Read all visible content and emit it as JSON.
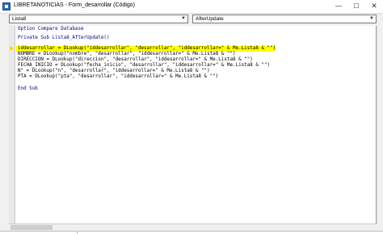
{
  "window": {
    "title": "LIBRETANOTICIAS - Form_desarrollar (Código)",
    "minimize_symbol": "—",
    "maximize_symbol": "☐",
    "close_symbol": "✕"
  },
  "selectors": {
    "object": "Lista8",
    "procedure": "AfterUpdate",
    "arrow_symbol": "▼"
  },
  "code": {
    "lines": [
      "Option Compare Database",
      "",
      "Private Sub Lista8_AfterUpdate()",
      "",
      "iddesarrollar = DLookup(\"iddesarrollar\", \"desarrollar\", \"iddesarrollar=\" & Me.Lista8 & \"\")",
      "NOMBRE = DLookup(\"nombre\", \"desarrollar\", \"iddesarrollar=\" & Me.Lista8 & \"\")",
      "DIRECCION = DLookup(\"direccion\", \"desarrollar\", \"iddesarrollar=\" & Me.Lista8 & \"\")",
      "FECHA_INICIO = DLookup(\"fecha_inicio\", \"desarrollar\", \"iddesarrollar=\" & Me.Lista8 & \"\")",
      "N° = DLookup(\"n\", \"desarrollar\", \"iddesarrollar=\" & Me.Lista8 & \"\")",
      "PTA = DLookup(\"pta\", \"desarrollar\", \"iddesarrollar=\" & Me.Lista8 & \"\")",
      "",
      "End Sub"
    ]
  },
  "colors": {
    "keyword": "#00008b",
    "highlight": "#ffff00",
    "breakpoint_arrow": "#f5d60a"
  }
}
